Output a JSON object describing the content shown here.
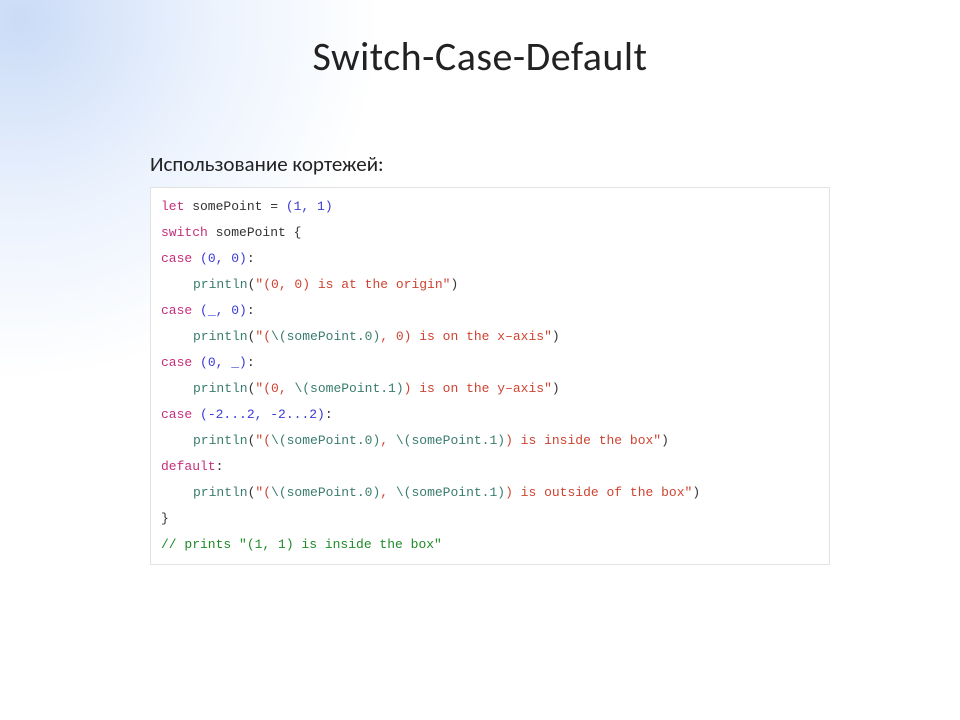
{
  "title": "Switch-Case-Default",
  "subtitle": "Использование кортежей:",
  "code": {
    "l1": {
      "kw": "let",
      "rest": " somePoint = ",
      "val": "(1, 1)"
    },
    "l2": {
      "kw": "switch",
      "rest": " somePoint {"
    },
    "l3": {
      "kw": "case",
      "sp": " ",
      "val": "(0, 0)",
      "colon": ":"
    },
    "l4": {
      "fn": "println",
      "open": "(",
      "str": "\"(0, 0) is at the origin\"",
      "close": ")"
    },
    "l5": {
      "kw": "case",
      "sp": " ",
      "val": "(_, 0)",
      "colon": ":"
    },
    "l6": {
      "fn": "println",
      "open": "(",
      "s1": "\"(",
      "i1": "\\(somePoint.0)",
      "s2": ", 0) is on the x–axis\"",
      "close": ")"
    },
    "l7": {
      "kw": "case",
      "sp": " ",
      "val": "(0, _)",
      "colon": ":"
    },
    "l8": {
      "fn": "println",
      "open": "(",
      "s1": "\"(0, ",
      "i1": "\\(somePoint.1)",
      "s2": ") is on the y–axis\"",
      "close": ")"
    },
    "l9": {
      "kw": "case",
      "sp": " ",
      "val": "(-2...2, -2...2)",
      "colon": ":"
    },
    "l10": {
      "fn": "println",
      "open": "(",
      "s1": "\"(",
      "i1": "\\(somePoint.0)",
      "s2": ", ",
      "i2": "\\(somePoint.1)",
      "s3": ") is inside the box\"",
      "close": ")"
    },
    "l11": {
      "kw": "default",
      "colon": ":"
    },
    "l12": {
      "fn": "println",
      "open": "(",
      "s1": "\"(",
      "i1": "\\(somePoint.0)",
      "s2": ", ",
      "i2": "\\(somePoint.1)",
      "s3": ") is outside of the box\"",
      "close": ")"
    },
    "l13": {
      "txt": "}"
    },
    "l14": {
      "txt": "// prints \"(1, 1) is inside the box\""
    }
  }
}
